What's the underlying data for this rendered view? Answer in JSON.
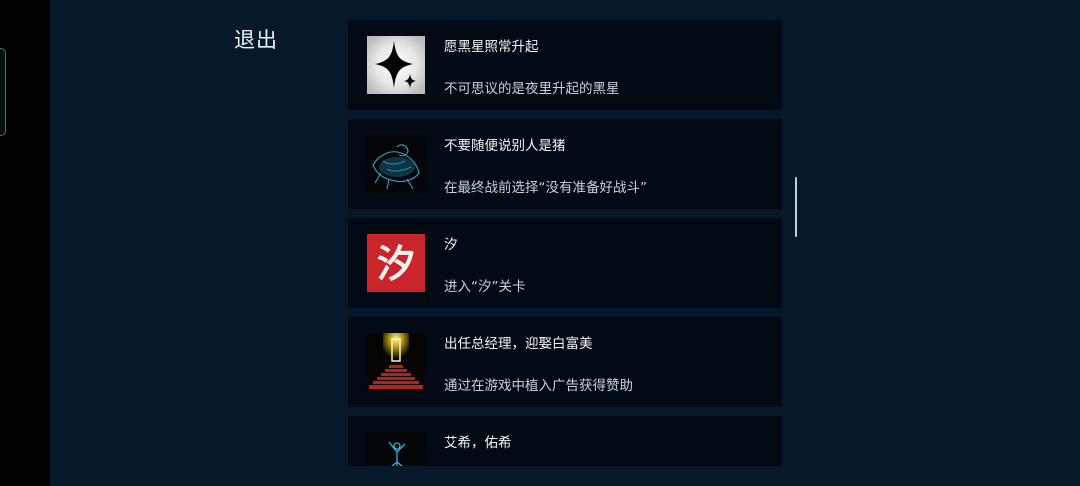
{
  "header": {
    "exit_label": "退出"
  },
  "achievements": [
    {
      "title": "愿黑星照常升起",
      "description": "不可思议的是夜里升起的黑星",
      "icon": "black-star-icon"
    },
    {
      "title": "不要随便说别人是猪",
      "description": "在最终战前选择“没有准备好战斗”",
      "icon": "crouching-figure-icon"
    },
    {
      "title": "汐",
      "description": "进入“汐”关卡",
      "icon": "xi-character-icon",
      "icon_text": "汐"
    },
    {
      "title": "出任总经理，迎娶白富美",
      "description": "通过在游戏中植入广告获得赞助",
      "icon": "golden-door-icon"
    },
    {
      "title": "艾希，佑希",
      "description": "",
      "icon": "blue-figure-icon"
    }
  ],
  "colors": {
    "background": "#05192a",
    "card": "#020b14",
    "accent_red": "#c8262c"
  }
}
